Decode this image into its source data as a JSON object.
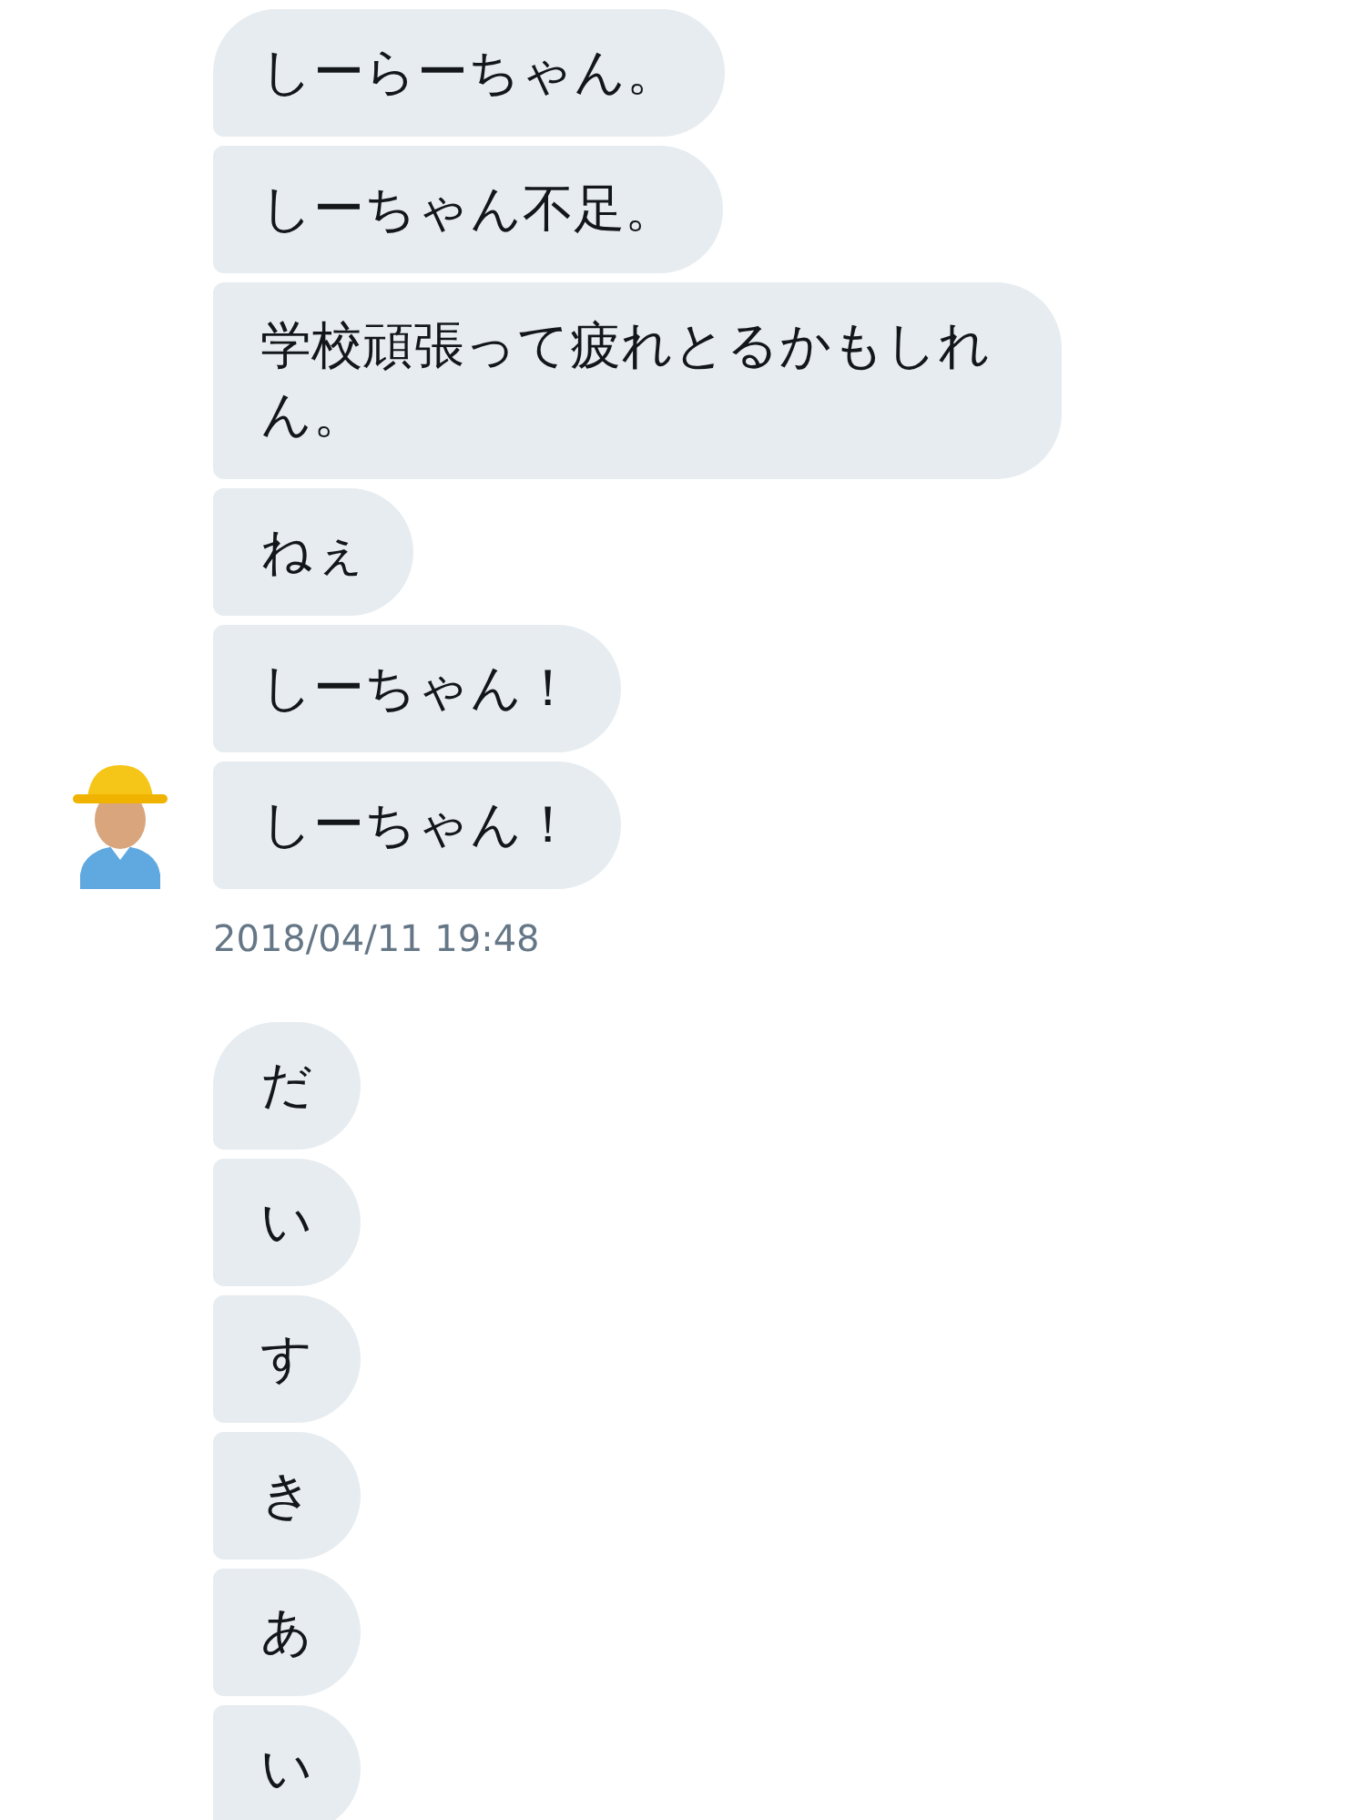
{
  "groups": [
    {
      "avatar": true,
      "messages": [
        "しーらーちゃん。",
        "しーちゃん不足。",
        "学校頑張って疲れとるかもしれん。",
        "ねぇ",
        "しーちゃん！",
        "しーちゃん！"
      ],
      "time": "2018/04/11 19:48"
    },
    {
      "avatar": false,
      "messages": [
        "だ",
        "い",
        "す",
        "き",
        "あ",
        "い"
      ]
    }
  ]
}
